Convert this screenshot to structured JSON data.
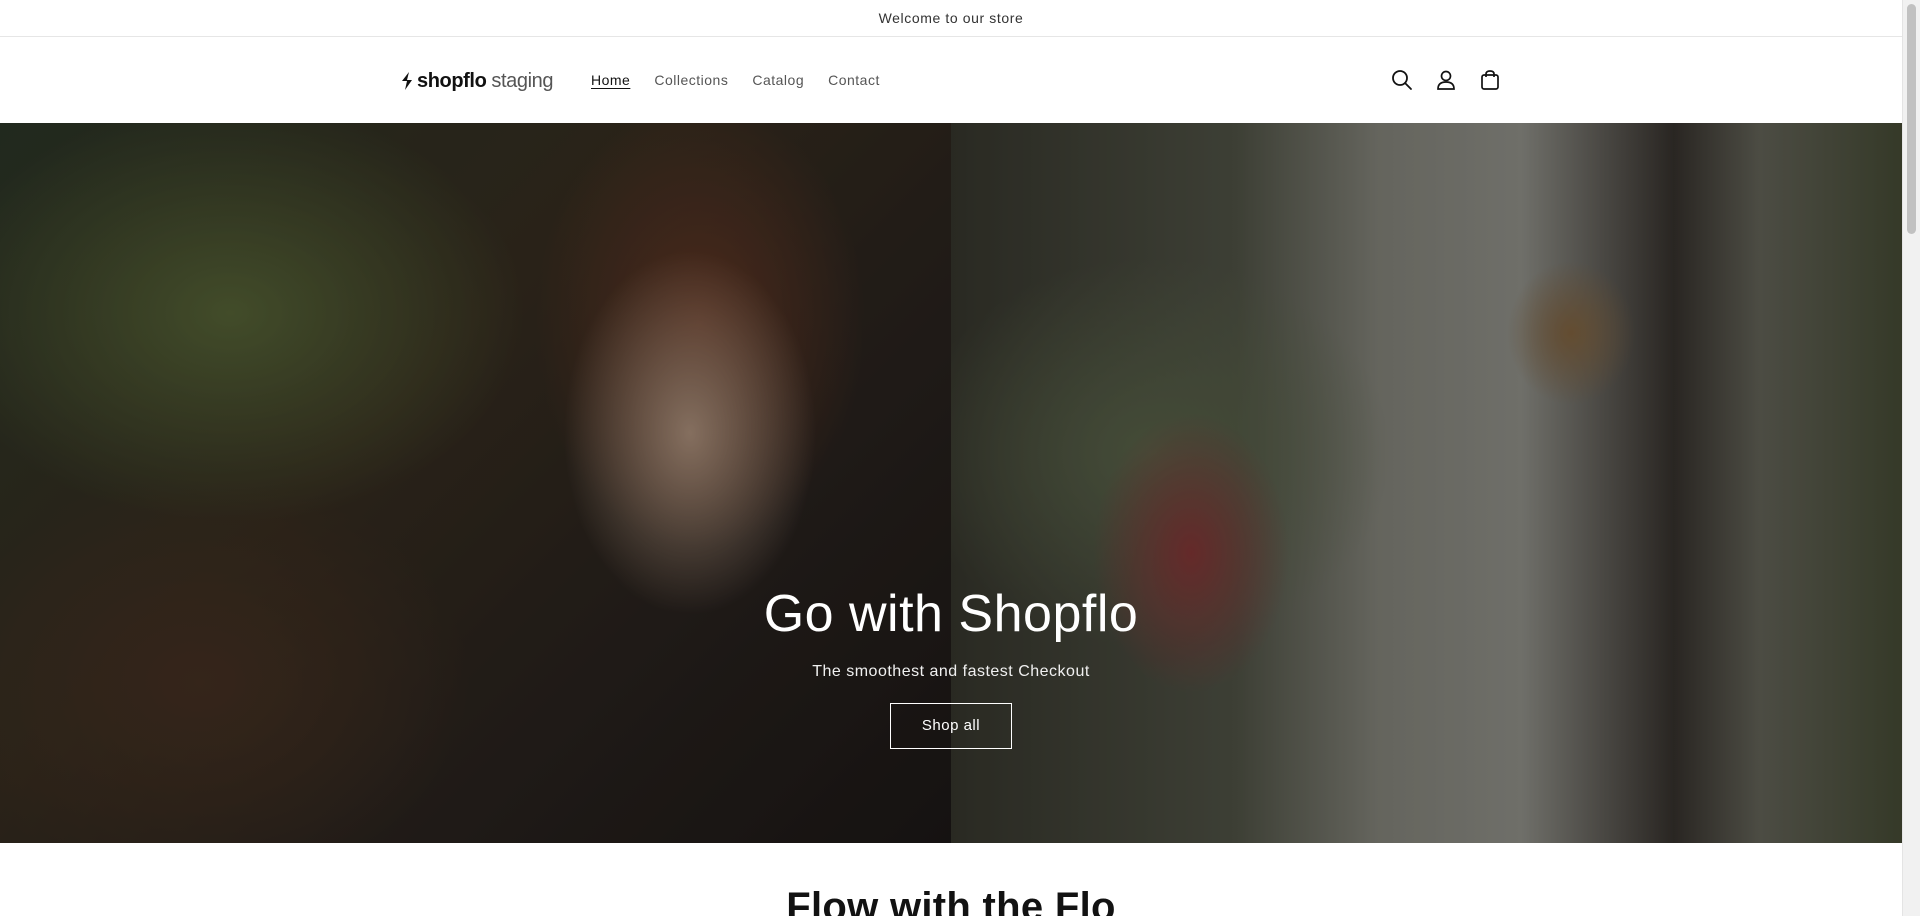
{
  "announcement": {
    "text": "Welcome to our store"
  },
  "header": {
    "logo": {
      "brand": "shopflo",
      "env": "staging"
    },
    "nav": [
      {
        "label": "Home",
        "active": true
      },
      {
        "label": "Collections",
        "active": false
      },
      {
        "label": "Catalog",
        "active": false
      },
      {
        "label": "Contact",
        "active": false
      }
    ],
    "icons": [
      "search-icon",
      "account-icon",
      "cart-icon"
    ]
  },
  "hero": {
    "title": "Go with Shopflo",
    "subtitle": "The smoothest and fastest Checkout",
    "button_label": "Shop all"
  },
  "section": {
    "title": "Flow with the Flo"
  }
}
